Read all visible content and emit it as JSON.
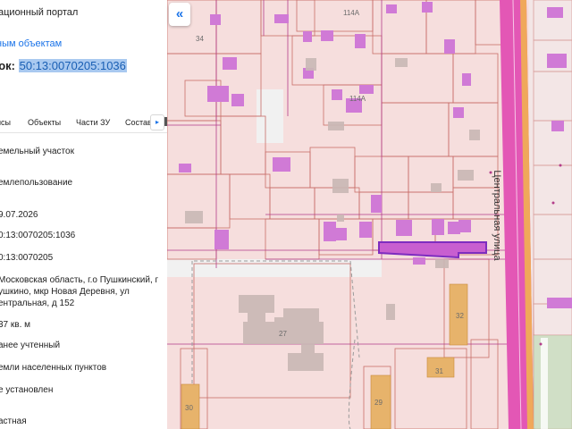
{
  "panel": {
    "portal_title": "ационный портал",
    "objects_link": "ным объектам",
    "cad_label": "ток:",
    "cad_number": "50:13:0070205:1036",
    "tabs": [
      "исы",
      "Объекты",
      "Части ЗУ",
      "Состав"
    ],
    "fields": [
      "емельный участок",
      "емлепользование",
      "9.07.2026",
      "0:13:0070205:1036",
      "0:13:0070205",
      "Московская область, г.о Пушкинский, г",
      "ушкино, мкр Новая Деревня, ул",
      "ентральная, д 152",
      "37 кв. м",
      "анее учтенный",
      "емли населенных пунктов",
      "е установлен",
      "астная"
    ]
  },
  "map": {
    "collapse_icon": "«",
    "street_label": "Центральная улица",
    "house_numbers": [
      "34",
      "114А",
      "114А",
      "27",
      "32",
      "31",
      "29",
      "30"
    ],
    "colors": {
      "land": "#f6dedd",
      "parcel_border": "#c86e6a",
      "building": "#d07ad6",
      "road": "#e357b5",
      "selected": "#7e2dbf",
      "grey_building": "#c9b8b5"
    }
  }
}
